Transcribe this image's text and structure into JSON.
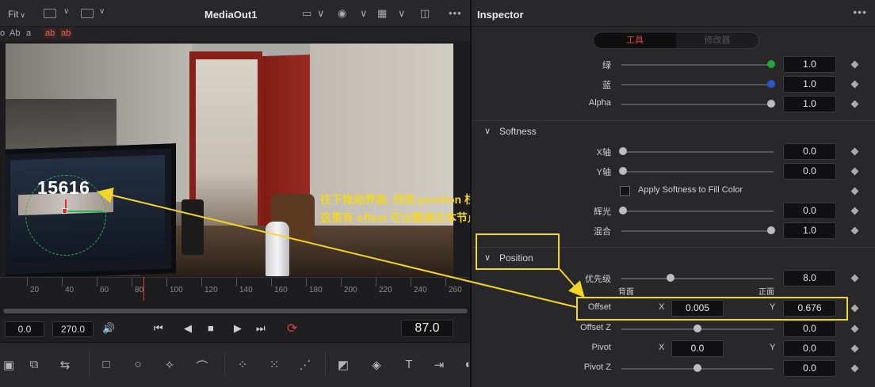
{
  "viewer": {
    "fit_label": "Fit",
    "title": "MediaOut1",
    "subbar": [
      "o",
      "Ab",
      "a",
      "ab",
      "ab"
    ],
    "overlay_text": "15616",
    "annotation_line1": "往下拖动界面, 找到 position 栏,",
    "annotation_line2": "这里有 offset 可以微调文本节点的位置",
    "ruler_labels": [
      "20",
      "40",
      "60",
      "80",
      "100",
      "120",
      "140",
      "160",
      "180",
      "200",
      "220",
      "240",
      "260"
    ],
    "in_point": "0.0",
    "out_point": "270.0",
    "current_frame": "87.0"
  },
  "inspector": {
    "title": "Inspector",
    "tabs": {
      "tools": "工具",
      "modifiers": "修改器"
    },
    "rows": {
      "green": {
        "label": "绿",
        "value": "1.0",
        "knob_color": "#1fa83a",
        "position": 1.0
      },
      "blue": {
        "label": "蓝",
        "value": "1.0",
        "knob_color": "#2857c8",
        "position": 1.0
      },
      "alpha": {
        "label": "Alpha",
        "value": "1.0",
        "knob_color": "#bdbdbd",
        "position": 1.0
      }
    },
    "softness": {
      "title": "Softness",
      "x_label": "X轴",
      "x_value": "0.0",
      "y_label": "Y轴",
      "y_value": "0.0",
      "apply_label": "Apply Softness to Fill Color",
      "glow_label": "辉光",
      "glow_value": "0.0",
      "blend_label": "混合",
      "blend_value": "1.0"
    },
    "position": {
      "title": "Position",
      "priority_label": "优先级",
      "priority_value": "8.0",
      "back_label": "背面",
      "front_label": "正面",
      "offset_label": "Offset",
      "offset_x": "0.005",
      "offset_y": "0.676",
      "offset_z_label": "Offset Z",
      "offset_z": "0.0",
      "pivot_label": "Pivot",
      "pivot_x": "0.0",
      "pivot_y": "0.0",
      "pivot_z_label": "Pivot Z",
      "pivot_z": "0.0",
      "x_axis": "X",
      "y_axis": "Y"
    }
  },
  "colors": {
    "accent_red": "#e04040",
    "annotation_yellow": "#f3d628"
  }
}
